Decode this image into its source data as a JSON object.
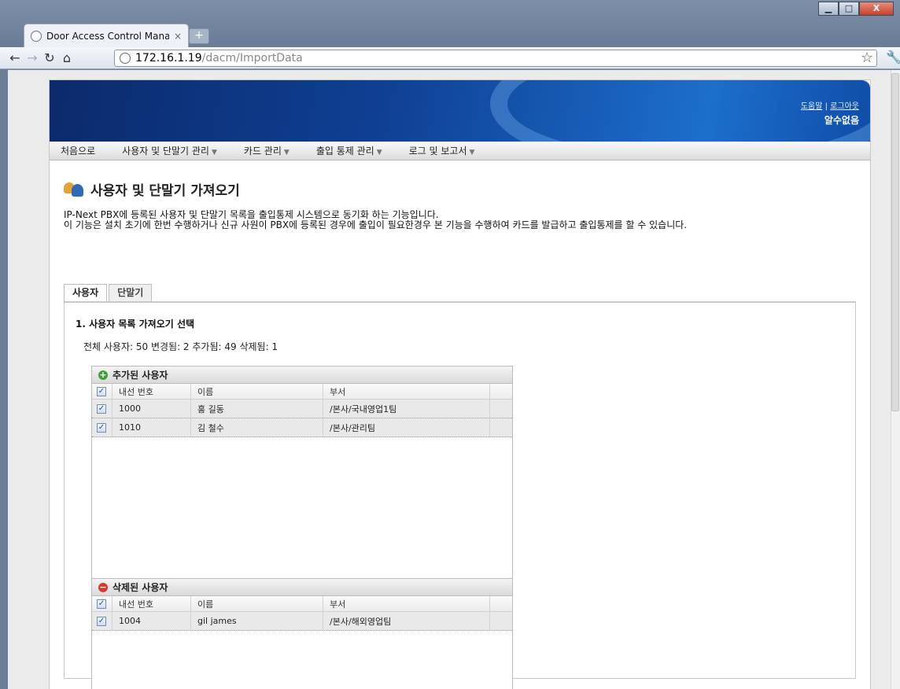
{
  "browser": {
    "tab_title": "Door Access Control Mana",
    "tab_close": "×",
    "new_tab": "+",
    "url_host": "172.16.1.19",
    "url_path": "/dacm/ImportData",
    "win_minimize": "▁",
    "win_maximize": "□",
    "win_close": "X"
  },
  "banner": {
    "help_link": "도움말",
    "separator": "|",
    "logout_link": "로그아웃",
    "user_name": "알수없음"
  },
  "menu": {
    "home": "처음으로",
    "users_devices": "사용자 및 단말기 관리",
    "cards": "카드 관리",
    "access_control": "출입 통제 관리",
    "logs_reports": "로그 및 보고서"
  },
  "page": {
    "title": "사용자 및 단말기 가져오기",
    "desc_line1": "IP-Next PBX에 등록된 사용자 및 단말기 목록을 출입통제 시스템으로 동기화 하는 기능입니다.",
    "desc_line2": "이 기능은 설치 초기에 한번 수행하거나 신규 사원이 PBX에 등록된 경우에 출입이 필요한경우 본 기능을 수행하여 카드를 발급하고 출입통제를 할 수 있습니다."
  },
  "tabs": {
    "users": "사용자",
    "devices": "단말기"
  },
  "section": {
    "title": "1. 사용자 목록 가져오기 선택",
    "stats": "전체 사용자: 50  변경됨: 2  추가됨: 49  삭제됨: 1"
  },
  "added_grid": {
    "title": "추가된 사용자",
    "col_ext": "내선 번호",
    "col_name": "이름",
    "col_dept": "부서",
    "rows": [
      {
        "ext": "1000",
        "name": "홍 길동",
        "dept": "/본사/국내영업1팀"
      },
      {
        "ext": "1010",
        "name": "김 철수",
        "dept": "/본사/관리팀"
      }
    ]
  },
  "deleted_grid": {
    "title": "삭제된 사용자",
    "col_ext": "내선 번호",
    "col_name": "이름",
    "col_dept": "부서",
    "rows": [
      {
        "ext": "1004",
        "name": "gil james",
        "dept": "/본사/해외영업팀"
      }
    ]
  },
  "checkmark": "✓"
}
